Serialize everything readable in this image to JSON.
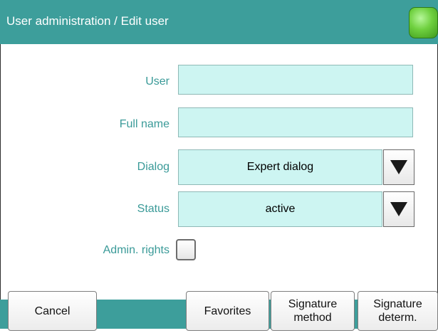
{
  "window": {
    "title": "User administration / Edit user"
  },
  "form": {
    "user_label": "User",
    "user_value": "",
    "fullname_label": "Full name",
    "fullname_value": "",
    "dialog_label": "Dialog",
    "dialog_value": "Expert dialog",
    "status_label": "Status",
    "status_value": "active",
    "admin_label": "Admin. rights",
    "admin_checked": false
  },
  "buttons": {
    "cancel": "Cancel",
    "favorites": "Favorites",
    "signature_method": "Signature\nmethod",
    "signature_determ": "Signature\ndeterm."
  },
  "colors": {
    "accent": "#3d9e9b",
    "field_bg": "#cdf5f2",
    "label_text": "#3a9a98",
    "status_led": "#6fd03f"
  }
}
